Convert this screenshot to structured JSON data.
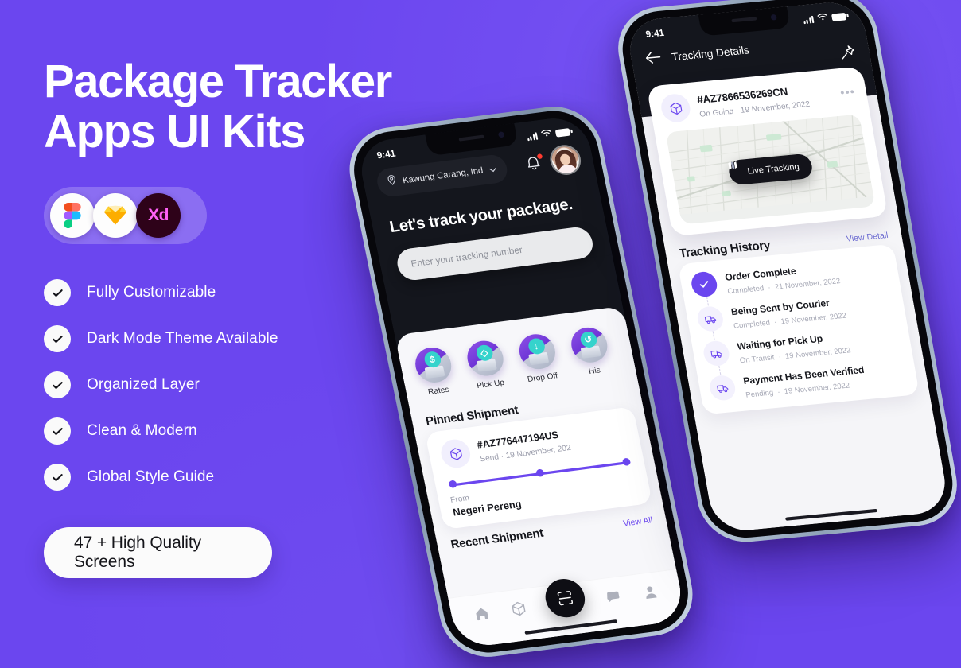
{
  "theme": {
    "background": "#6B46EF",
    "accent": "#6B46EF",
    "dark": "#14161D",
    "white": "#FFFFFF"
  },
  "hero": {
    "headline": "Package Tracker\nApps UI Kits",
    "app_badges": [
      {
        "name": "figma",
        "label": "Figma"
      },
      {
        "name": "sketch",
        "label": "Sketch"
      },
      {
        "name": "adobe-xd",
        "label": "Xd"
      }
    ],
    "features": [
      {
        "label": "Fully Customizable"
      },
      {
        "label": "Dark Mode Theme Available"
      },
      {
        "label": "Organized Layer"
      },
      {
        "label": "Clean & Modern"
      },
      {
        "label": "Global Style Guide"
      }
    ],
    "cta": "47 + High Quality Screens"
  },
  "phone_home": {
    "status": {
      "time": "9:41",
      "signal_icon": "cellular-bars-icon",
      "wifi_icon": "wifi-icon",
      "battery_icon": "battery-icon"
    },
    "location": {
      "icon": "map-pin-icon",
      "label": "Kawung Carang, Ind",
      "chevron": "chevron-down-icon"
    },
    "bell_icon": "bell-icon",
    "avatar": "user-avatar",
    "title": "Let's track your package.",
    "search_placeholder": "Enter your tracking number",
    "quick_actions": [
      {
        "label": "Rates",
        "glyph": "$"
      },
      {
        "label": "Pick Up",
        "glyph": "◇"
      },
      {
        "label": "Drop Off",
        "glyph": "↓"
      },
      {
        "label": "His",
        "glyph": "↺"
      }
    ],
    "pinned": {
      "section_title": "Pinned Shipment",
      "code": "#AZ776447194US",
      "meta": "Send  ·  19 November, 202",
      "from_label": "From",
      "from_value": "Negeri Pereng"
    },
    "recent": {
      "section_title": "Recent Shipment",
      "view_all": "View All"
    },
    "tabs": [
      {
        "name": "home",
        "icon": "home-icon"
      },
      {
        "name": "packages",
        "icon": "box-icon"
      },
      {
        "name": "scan",
        "icon": "scan-icon"
      },
      {
        "name": "messages",
        "icon": "chat-icon"
      },
      {
        "name": "profile",
        "icon": "person-icon"
      }
    ]
  },
  "phone_detail": {
    "status": {
      "time": "9:41",
      "signal_icon": "cellular-bars-icon",
      "wifi_icon": "wifi-icon",
      "battery_icon": "battery-icon"
    },
    "nav": {
      "back_icon": "arrow-left-icon",
      "title": "Tracking Details",
      "pin_icon": "pin-icon"
    },
    "tracking_card": {
      "icon": "box-icon",
      "code": "#AZ7866536269CN",
      "meta": "On Going  ·  19 November, 2022",
      "more_icon": "ellipsis-icon",
      "live_button": "Live Tracking",
      "live_icon": "map-icon"
    },
    "history": {
      "title": "Tracking History",
      "link": "View Detail",
      "items": [
        {
          "name": "Order Complete",
          "status": "Completed",
          "date": "21 November, 2022",
          "icon": "check-icon",
          "state": "done"
        },
        {
          "name": "Being Sent by Courier",
          "status": "Completed",
          "date": "19 November, 2022",
          "icon": "truck-icon",
          "state": "pending"
        },
        {
          "name": "Waiting for Pick Up",
          "status": "On Transit",
          "date": "19 November, 2022",
          "icon": "truck-icon",
          "state": "pending"
        },
        {
          "name": "Payment Has Been Verified",
          "status": "Pending",
          "date": "19 November, 2022",
          "icon": "truck-icon",
          "state": "pending"
        }
      ]
    }
  }
}
